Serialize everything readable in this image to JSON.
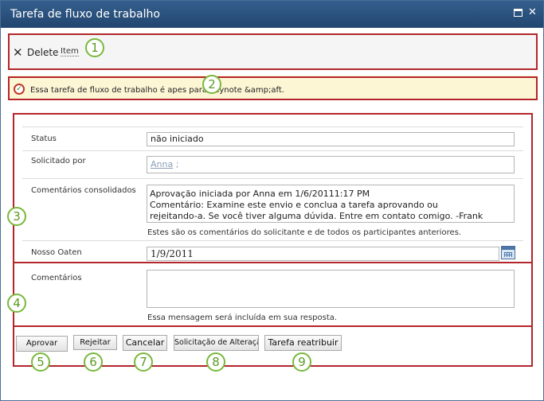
{
  "window": {
    "title": "Tarefa de fluxo de trabalho"
  },
  "ribbon": {
    "delete_label": "Delete",
    "item_label": "Item"
  },
  "notice": {
    "text": "Essa tarefa de fluxo de trabalho é apes para Keynote &amp;aft."
  },
  "form": {
    "status": {
      "label": "Status",
      "value": "não iniciado"
    },
    "requested_by": {
      "label": "Solicitado por",
      "value": "Anna",
      "suffix": " ;"
    },
    "consolidated_comments": {
      "label": "Comentários consolidados",
      "lines": [
        "Aprovação iniciada por Anna em 1/6/20111:17 PM",
        "Comentário: Examine este envio e conclua a tarefa aprovando ou",
        "rejeitando-a. Se você tiver alguma dúvida. Entre em contato comigo. -Frank"
      ],
      "hint": "Estes são os comentários do solicitante e de todos os participantes anteriores."
    },
    "due_date": {
      "label": "Nosso Oaten",
      "value": "1/9/2011"
    },
    "comments": {
      "label": "Comentários",
      "value": "",
      "hint": "Essa mensagem será incluída em sua resposta."
    }
  },
  "buttons": {
    "approve": "Aprovar",
    "reject": "Rejeitar",
    "cancel": "Cancelar",
    "request_change": "Solicitação de Alteração",
    "reassign": "Tarefa reatribuir"
  },
  "callouts": [
    "1",
    "2",
    "3",
    "4",
    "5",
    "6",
    "7",
    "8",
    "9"
  ],
  "colors": {
    "titlebar": "#2b537f",
    "highlight_border": "#b3262b",
    "callout": "#78b83b",
    "notice_bg": "#fdf6d5"
  },
  "icons": {
    "delete": "x-icon",
    "notice": "workflow-task-icon",
    "date": "calendar-icon",
    "maximize": "maximize-icon",
    "close": "close-icon"
  }
}
